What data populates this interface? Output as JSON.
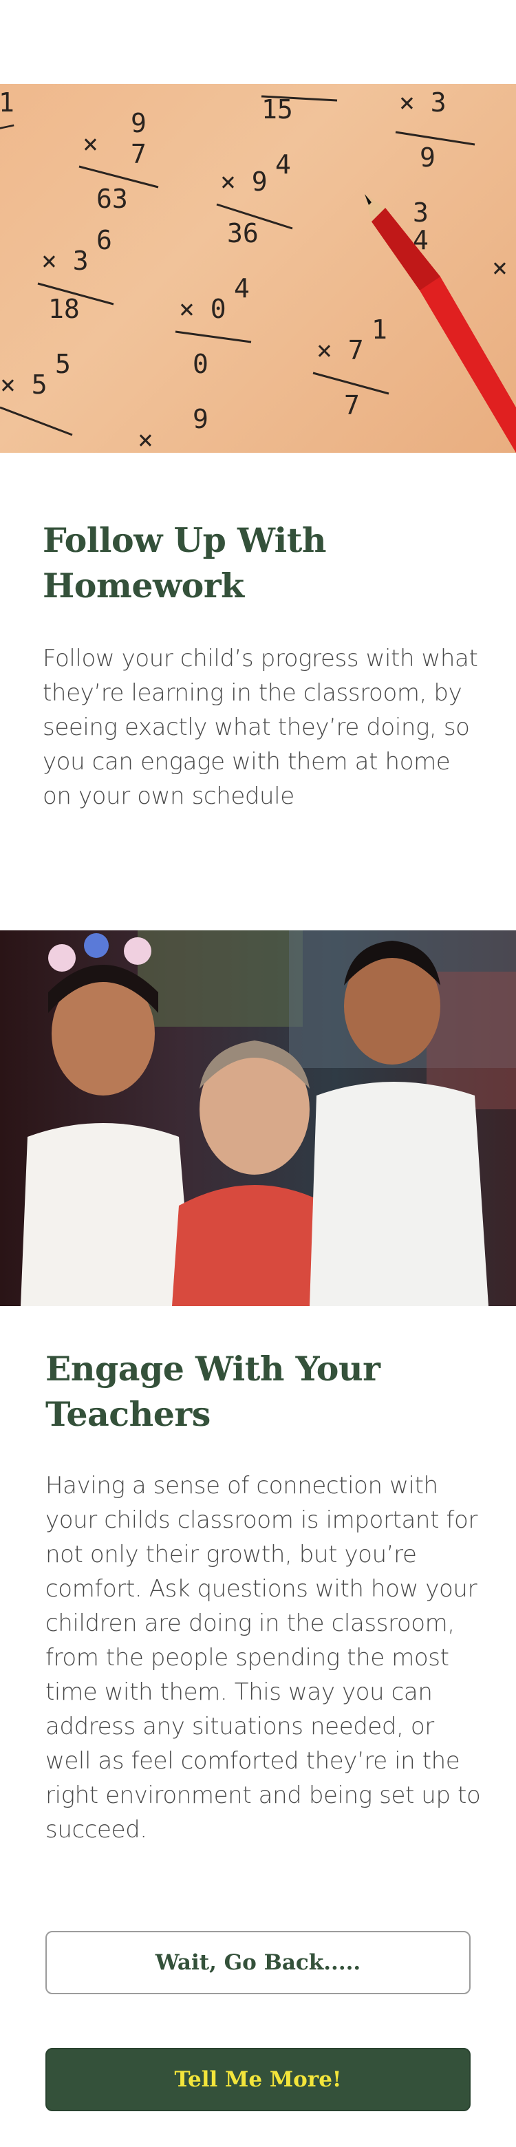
{
  "sections": [
    {
      "image_alt_icon": "math-worksheet-with-pencil-photo",
      "title": "Follow Up With Homework",
      "body": "Follow your child’s progress with what they’re learning in the classroom, by seeing exactly what they’re doing, so you can engage with them at home on your own schedule"
    },
    {
      "image_alt_icon": "teacher-with-two-children-photo",
      "title": "Engage With Your Teachers",
      "body": "Having a sense of connection with your childs classroom is important for not only their growth, but you’re comfort.  Ask questions with how your children are doing in the classroom, from the people spending the most time with them.  This way you can address any situations needed, or well as feel comforted they’re in the right environment and being set up to succeed."
    }
  ],
  "buttons": {
    "back_label": "Wait, Go Back.....",
    "more_label": "Tell Me More!"
  },
  "colors": {
    "heading": "#34513a",
    "primary_button_bg": "#34513a",
    "primary_button_text": "#f3e53b",
    "body_text": "#4a4a4a"
  }
}
